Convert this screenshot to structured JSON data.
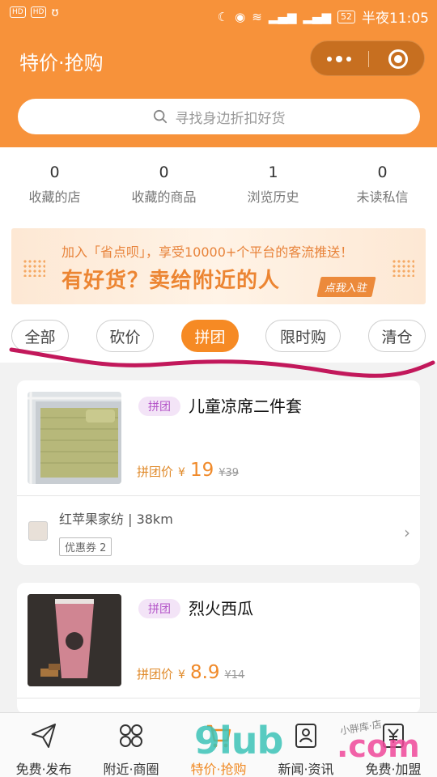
{
  "status_bar": {
    "left_chips": [
      "HD",
      "HD"
    ],
    "battery": "52",
    "time": "半夜11:05"
  },
  "header": {
    "title": "特价·抢购",
    "search_placeholder": "寻找身边折扣好货"
  },
  "stats": [
    {
      "count": "0",
      "label": "收藏的店"
    },
    {
      "count": "0",
      "label": "收藏的商品"
    },
    {
      "count": "1",
      "label": "浏览历史"
    },
    {
      "count": "0",
      "label": "未读私信"
    }
  ],
  "banner": {
    "line1": "加入「省点呗」，享受10000+个平台的客流推送！",
    "line2": "有好货？卖给附近的人",
    "cta": "点我入驻"
  },
  "tabs": [
    {
      "label": "全部",
      "active": false
    },
    {
      "label": "砍价",
      "active": false
    },
    {
      "label": "拼团",
      "active": true
    },
    {
      "label": "限时购",
      "active": false
    },
    {
      "label": "清仓",
      "active": false
    }
  ],
  "products": [
    {
      "tag": "拼团",
      "name": "儿童凉席二件套",
      "price_label": "拼团价",
      "currency": "¥",
      "price": "19",
      "old_price": "¥39",
      "store": "红苹果家纺 | 38km",
      "coupon": "优惠券 2"
    },
    {
      "tag": "拼团",
      "name": "烈火西瓜",
      "price_label": "拼团价",
      "currency": "¥",
      "price": "8.9",
      "old_price": "¥14"
    }
  ],
  "bottom_nav": [
    {
      "label": "免费·发布",
      "icon": "send-icon",
      "active": false
    },
    {
      "label": "附近·商圈",
      "icon": "grid-icon",
      "active": false
    },
    {
      "label": "特价·抢购",
      "icon": "cart-icon",
      "active": true
    },
    {
      "label": "新闻·资讯",
      "icon": "news-icon",
      "active": false
    },
    {
      "label": "免费·加盟",
      "icon": "join-icon",
      "active": false
    }
  ],
  "watermark": {
    "brand": "9lub",
    "domain": ".com",
    "handwriting": "小胖库·店"
  },
  "colors": {
    "header": "#f7923a",
    "accent": "#f68a24",
    "tag_bg": "#f3e4f7",
    "tag_text": "#b455c8",
    "annotation": "#c2185b"
  }
}
